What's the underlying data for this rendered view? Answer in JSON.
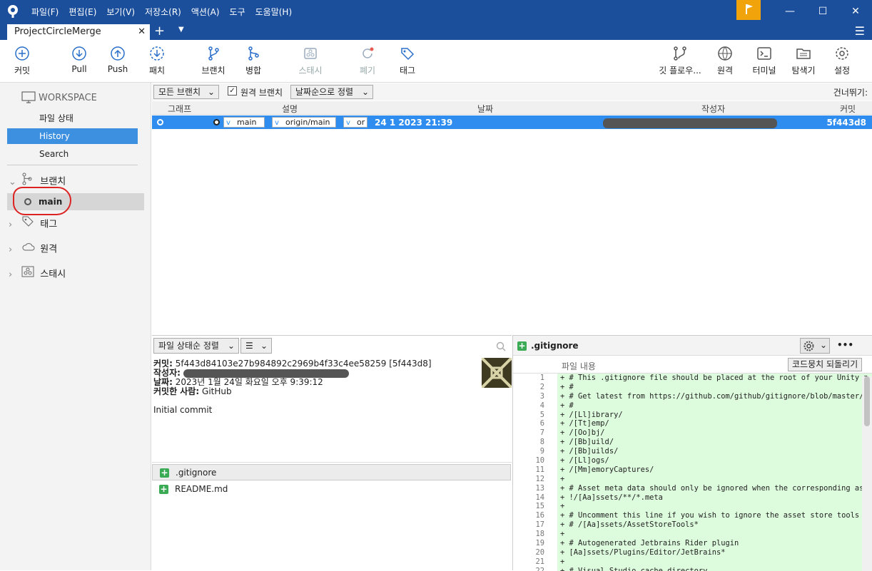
{
  "menu": [
    "파일(F)",
    "편집(E)",
    "보기(V)",
    "저장소(R)",
    "액션(A)",
    "도구",
    "도움말(H)"
  ],
  "tab": {
    "title": "ProjectCircleMerge"
  },
  "toolbar": {
    "commit": "커밋",
    "pull": "Pull",
    "push": "Push",
    "fetch": "패치",
    "branch": "브랜치",
    "merge": "병합",
    "stash": "스태시",
    "discard": "폐기",
    "tag": "태그",
    "gitflow": "깃 플로우...",
    "remote": "원격",
    "terminal": "터미널",
    "explorer": "탐색기",
    "settings": "설정"
  },
  "sidebar": {
    "workspace": "WORKSPACE",
    "file_status": "파일 상태",
    "history": "History",
    "search": "Search",
    "branches": "브랜치",
    "main_branch": "main",
    "tags": "태그",
    "remotes": "원격",
    "stashes": "스태시"
  },
  "filters": {
    "all_branches": "모든 브랜치",
    "remote_branches": "원격 브랜치",
    "remote_checked": true,
    "sort": "날짜순으로 정렬",
    "jump": "건너뛰기:"
  },
  "columns": {
    "graph": "그래프",
    "desc": "설명",
    "date": "날짜",
    "author": "작성자",
    "commit": "커밋"
  },
  "commits": [
    {
      "branch1": "main",
      "branch2": "origin/main",
      "branch3": "or",
      "date": "24 1 2023 21:39",
      "hash": "5f443d8"
    }
  ],
  "details": {
    "sort": "파일 상태순 정렬",
    "list_icon": "☰",
    "commit_label": "커밋:",
    "commit_value": "5f443d84103e27b984892c2969b4f33c4ee58259 [5f443d8]",
    "author_label": "작성자:",
    "date_label": "날짜:",
    "date_value": "2023년 1월 24일 화요일 오후 9:39:12",
    "committer_label": "커밋한 사람:",
    "committer_value": "GitHub",
    "message": "Initial commit",
    "files": [
      ".gitignore",
      "README.md"
    ]
  },
  "diff": {
    "file": ".gitignore",
    "content_label": "파일 내용",
    "revert_button": "코드뭉치 되돌리기",
    "more": "•••",
    "lines": [
      {
        "n": "1",
        "t": "+ # This .gitignore file should be placed at the root of your Unity p"
      },
      {
        "n": "2",
        "t": "+ #"
      },
      {
        "n": "3",
        "t": "+ # Get latest from https://github.com/github/gitignore/blob/master/U"
      },
      {
        "n": "4",
        "t": "+ #"
      },
      {
        "n": "5",
        "t": "+ /[Ll]ibrary/"
      },
      {
        "n": "6",
        "t": "+ /[Tt]emp/"
      },
      {
        "n": "7",
        "t": "+ /[Oo]bj/"
      },
      {
        "n": "8",
        "t": "+ /[Bb]uild/"
      },
      {
        "n": "9",
        "t": "+ /[Bb]uilds/"
      },
      {
        "n": "10",
        "t": "+ /[Ll]ogs/"
      },
      {
        "n": "11",
        "t": "+ /[Mm]emoryCaptures/"
      },
      {
        "n": "12",
        "t": "+"
      },
      {
        "n": "13",
        "t": "+ # Asset meta data should only be ignored when the corresponding ass"
      },
      {
        "n": "14",
        "t": "+ !/[Aa]ssets/**/*.meta"
      },
      {
        "n": "15",
        "t": "+"
      },
      {
        "n": "16",
        "t": "+ # Uncomment this line if you wish to ignore the asset store tools p"
      },
      {
        "n": "17",
        "t": "+ # /[Aa]ssets/AssetStoreTools*"
      },
      {
        "n": "18",
        "t": "+"
      },
      {
        "n": "19",
        "t": "+ # Autogenerated Jetbrains Rider plugin"
      },
      {
        "n": "20",
        "t": "+ [Aa]ssets/Plugins/Editor/JetBrains*"
      },
      {
        "n": "21",
        "t": "+"
      },
      {
        "n": "22",
        "t": "+ # Visual Studio cache directory"
      }
    ]
  }
}
